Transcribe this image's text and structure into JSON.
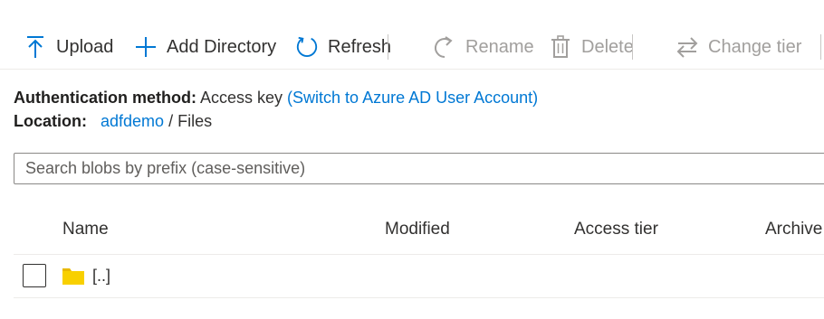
{
  "toolbar": {
    "upload": "Upload",
    "add_directory": "Add Directory",
    "refresh": "Refresh",
    "rename": "Rename",
    "delete": "Delete",
    "change_tier": "Change tier",
    "icons": [
      "upload-icon",
      "plus-icon",
      "refresh-icon",
      "rename-icon",
      "delete-icon",
      "change-tier-icon"
    ],
    "accent_color": "#0078d4",
    "disabled_color": "#a19f9d"
  },
  "info": {
    "auth_label": "Authentication method:",
    "auth_value": "Access key",
    "auth_switch_link": "(Switch to Azure AD User Account)",
    "location_label": "Location:",
    "location_link": "adfdemo",
    "location_sep": "/",
    "location_path": "Files"
  },
  "search": {
    "placeholder": "Search blobs by prefix (case-sensitive)",
    "value": ""
  },
  "table": {
    "columns": [
      "Name",
      "Modified",
      "Access tier",
      "Archive"
    ],
    "rows": [
      {
        "name": "[..]",
        "icon": "folder-icon",
        "modified": "",
        "access_tier": ""
      }
    ]
  }
}
